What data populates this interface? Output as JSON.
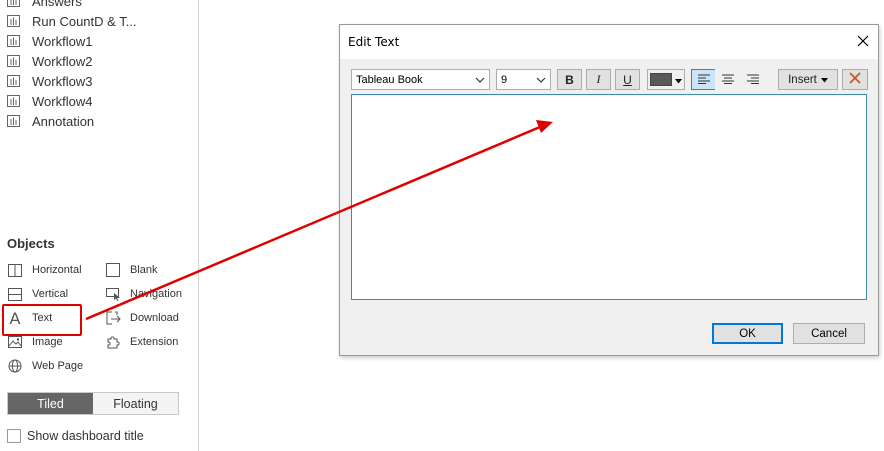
{
  "sheets": [
    {
      "label": "Answers",
      "icon": "sheet-icon"
    },
    {
      "label": "Run CountD & T...",
      "icon": "sheet-icon"
    },
    {
      "label": "Workflow1",
      "icon": "sheet-icon"
    },
    {
      "label": "Workflow2",
      "icon": "sheet-icon"
    },
    {
      "label": "Workflow3",
      "icon": "sheet-icon"
    },
    {
      "label": "Workflow4",
      "icon": "sheet-icon"
    },
    {
      "label": "Annotation",
      "icon": "sheet-icon"
    }
  ],
  "objects": {
    "title": "Objects",
    "items": {
      "horizontal": "Horizontal",
      "vertical": "Vertical",
      "text": "Text",
      "image": "Image",
      "webpage": "Web Page",
      "blank": "Blank",
      "navigation": "Navigation",
      "download": "Download",
      "extension": "Extension"
    }
  },
  "layout_toggle": {
    "tiled": "Tiled",
    "floating": "Floating",
    "selected": "Tiled"
  },
  "show_title_label": "Show dashboard title",
  "dialog": {
    "title": "Edit Text",
    "font": "Tableau Book",
    "size": "9",
    "bold": "B",
    "italic": "I",
    "underline": "U",
    "text_color": "#595959",
    "insert_label": "Insert",
    "ok_label": "OK",
    "cancel_label": "Cancel",
    "text_value": ""
  },
  "colors": {
    "highlight": "#e00000",
    "arrow": "#e00000",
    "accent": "#0078d7"
  }
}
